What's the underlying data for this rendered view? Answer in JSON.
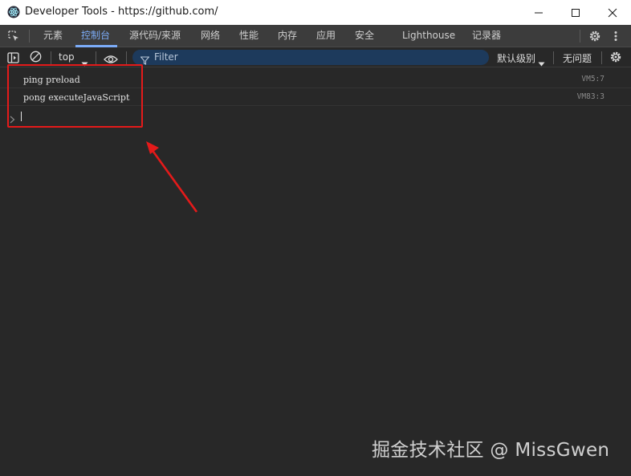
{
  "window": {
    "title": "Developer Tools - https://github.com/"
  },
  "tabs": [
    {
      "label": "元素",
      "active": false
    },
    {
      "label": "控制台",
      "active": true
    },
    {
      "label": "源代码/来源",
      "active": false
    },
    {
      "label": "网络",
      "active": false
    },
    {
      "label": "性能",
      "active": false
    },
    {
      "label": "内存",
      "active": false
    },
    {
      "label": "应用",
      "active": false
    },
    {
      "label": "安全",
      "active": false
    },
    {
      "label": "Lighthouse",
      "active": false
    },
    {
      "label": "记录器",
      "active": false
    }
  ],
  "toolbar": {
    "context": "top",
    "filter_placeholder": "Filter",
    "levels": "默认级别",
    "issues": "无问题"
  },
  "console": {
    "messages": [
      {
        "text": "ping preload",
        "source": "VM5:7"
      },
      {
        "text": "pong executeJavaScript",
        "source": "VM83:3"
      }
    ]
  },
  "watermark": "掘金技术社区 @ MissGwen",
  "colors": {
    "accent": "#7cacf8",
    "annotation_red": "#e41a1a",
    "console_bg": "#282828",
    "tabbar_bg": "#3c3c3c",
    "filter_bg": "#1d3a5c"
  },
  "icons": {
    "app": "electron-icon",
    "inspect": "inspect-element-icon",
    "sidebar": "sidebar-toggle-icon",
    "clear": "clear-console-icon",
    "eye": "live-expression-icon",
    "filter": "filter-icon",
    "settings": "gear-icon",
    "more": "more-vertical-icon"
  }
}
